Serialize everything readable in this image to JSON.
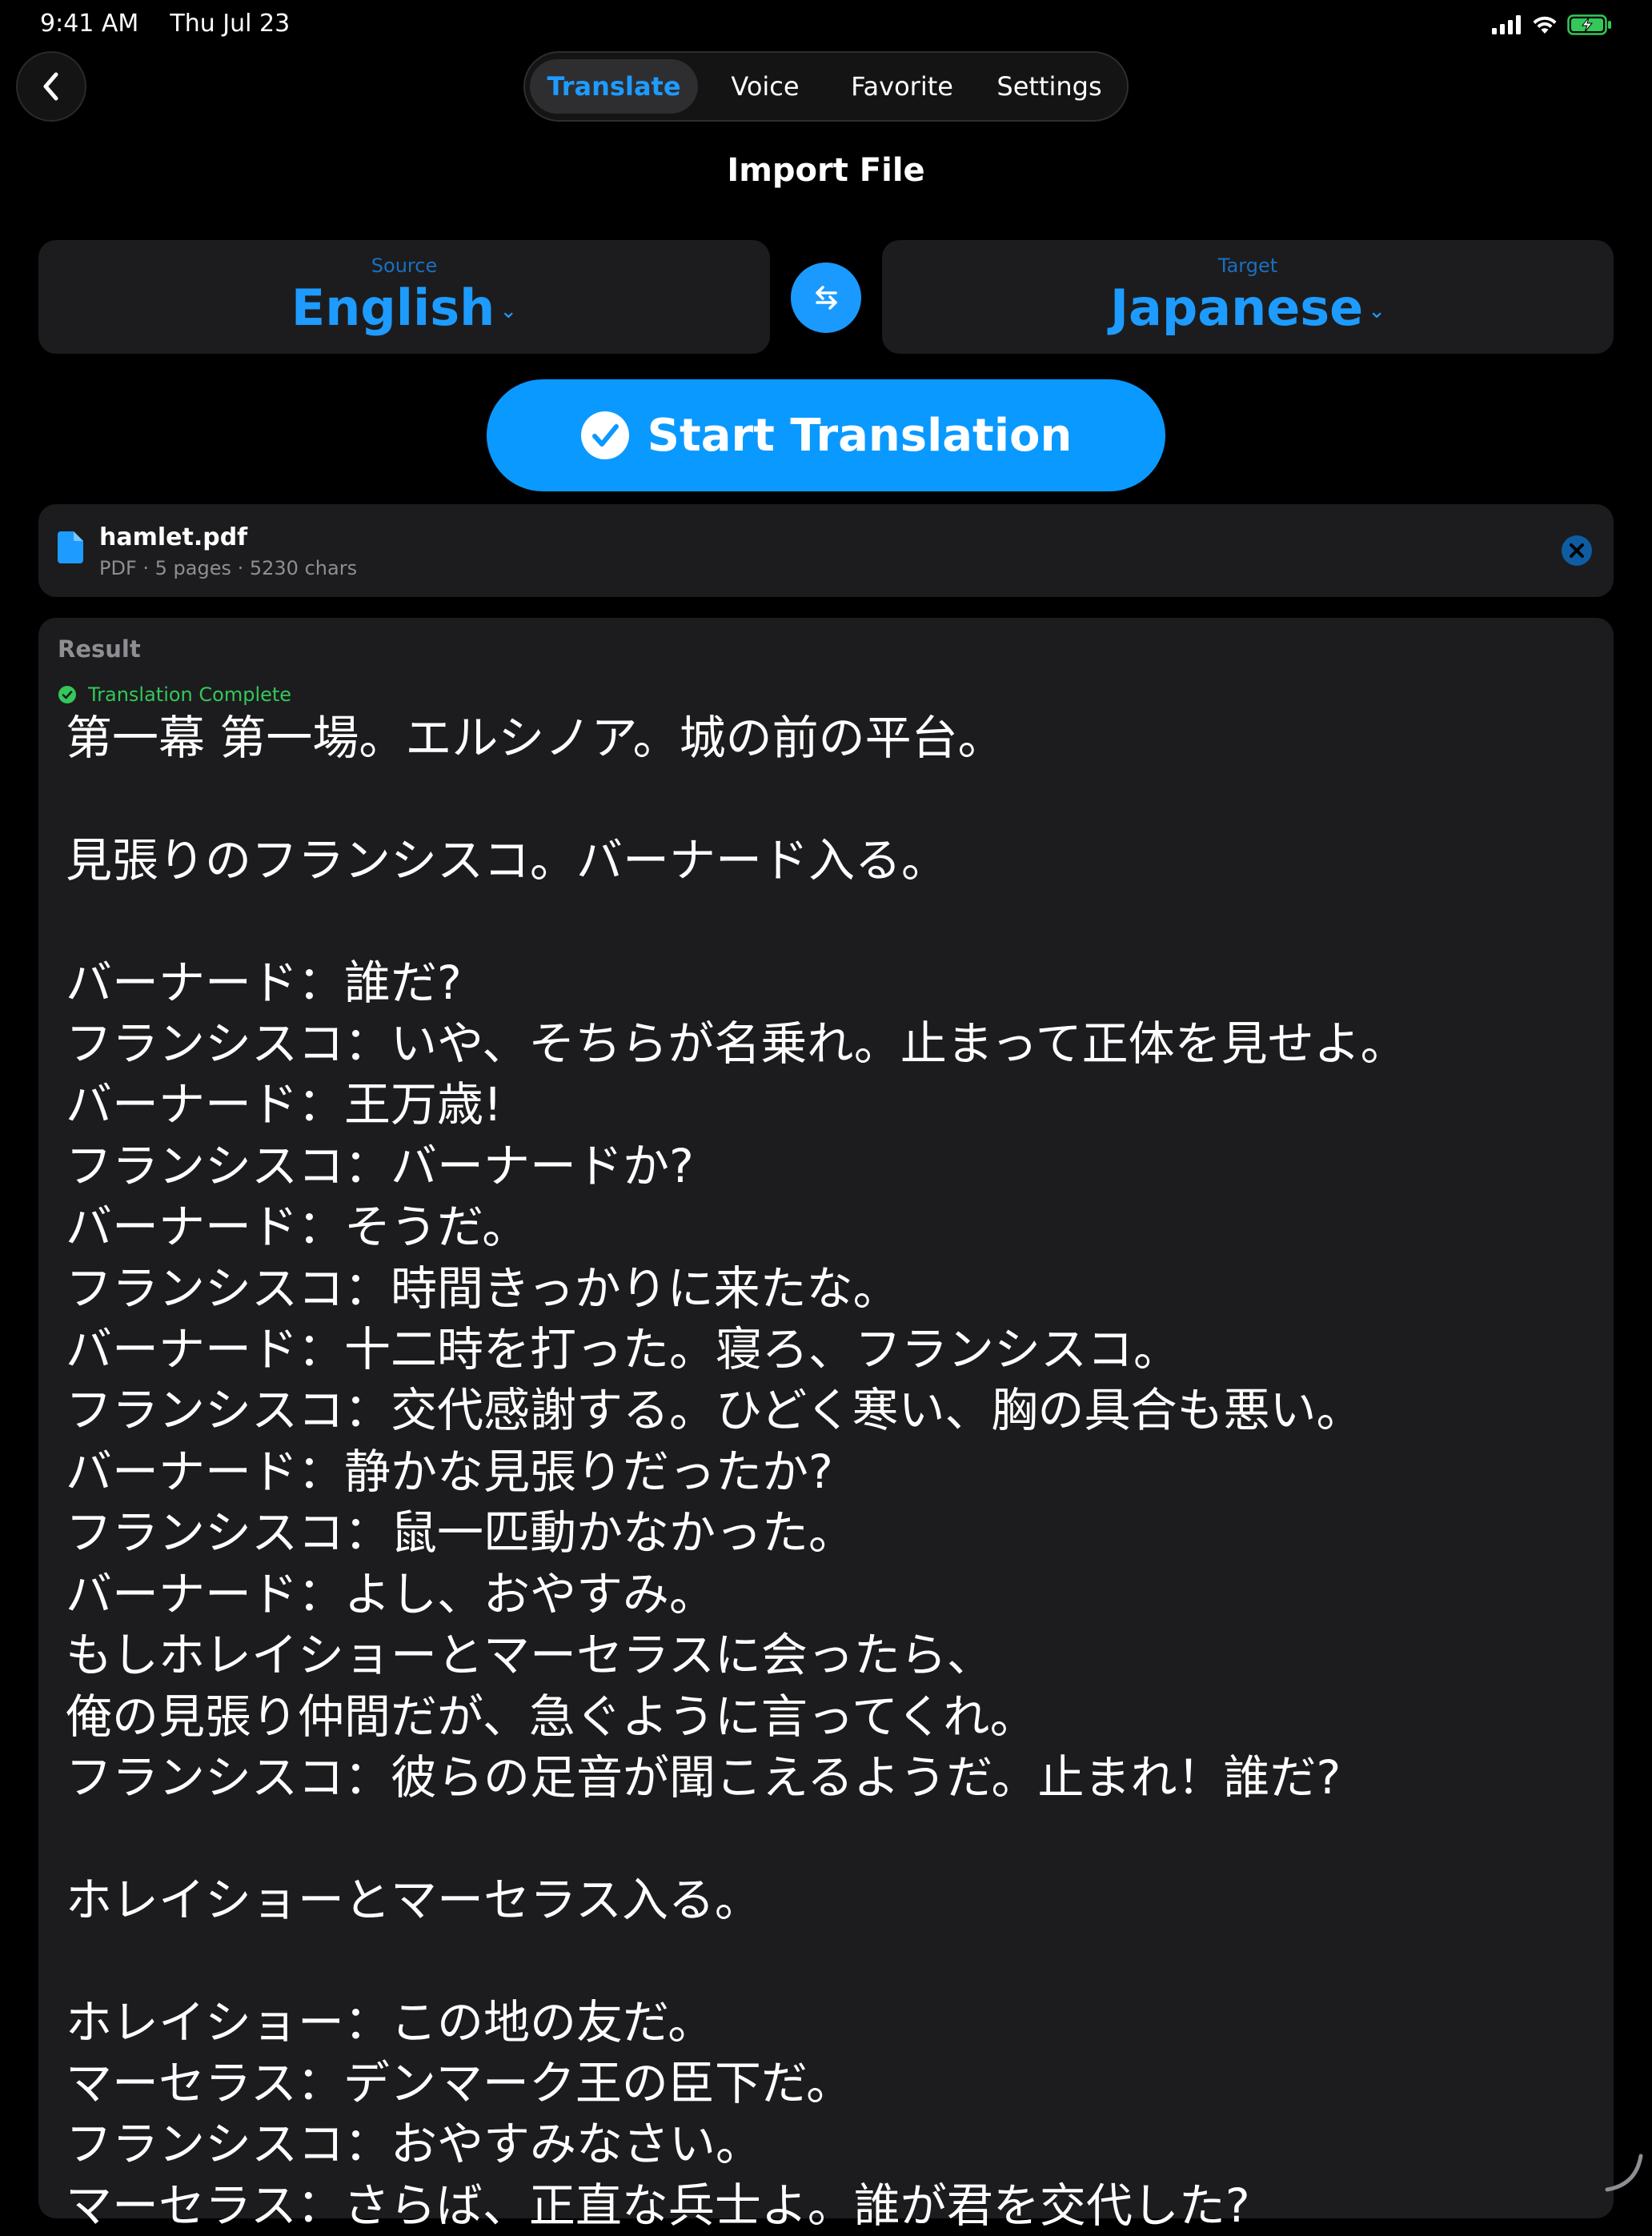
{
  "status_bar": {
    "time": "9:41 AM",
    "date": "Thu Jul 23",
    "icons": [
      "cellular-icon",
      "wifi-icon",
      "battery-charging-icon"
    ]
  },
  "nav": {
    "back_icon": "chevron-left-icon",
    "tabs": [
      {
        "label": "Translate",
        "active": true
      },
      {
        "label": "Voice",
        "active": false
      },
      {
        "label": "Favorite",
        "active": false
      },
      {
        "label": "Settings",
        "active": false
      }
    ]
  },
  "page": {
    "title": "Import File"
  },
  "languages": {
    "source": {
      "caption": "Source",
      "value": "English"
    },
    "target": {
      "caption": "Target",
      "value": "Japanese"
    },
    "swap_icon": "swap-arrows-icon"
  },
  "actions": {
    "start_label": "Start Translation",
    "start_icon": "checkmark-circle-icon"
  },
  "file": {
    "name": "hamlet.pdf",
    "meta": "PDF · 5 pages · 5230 chars",
    "icon": "document-icon",
    "remove_icon": "close-circle-icon"
  },
  "result": {
    "title": "Result",
    "status": "Translation Complete",
    "text": "第一幕 第一場。エルシノア。城の前の平台。\n\n見張りのフランシスコ。バーナード入る。\n\nバーナード：誰だ?\nフランシスコ：いや、そちらが名乗れ。止まって正体を見せよ。\nバーナード：王万歳!\nフランシスコ：バーナードか?\nバーナード：そうだ。\nフランシスコ：時間きっかりに来たな。\nバーナード：十二時を打った。寝ろ、フランシスコ。\nフランシスコ：交代感謝する。ひどく寒い、胸の具合も悪い。\nバーナード：静かな見張りだったか?\nフランシスコ：鼠一匹動かなかった。\nバーナード：よし、おやすみ。\nもしホレイショーとマーセラスに会ったら、\n俺の見張り仲間だが、急ぐように言ってくれ。\nフランシスコ：彼らの足音が聞こえるようだ。止まれ！誰だ?\n\nホレイショーとマーセラス入る。\n\nホレイショー：この地の友だ。\nマーセラス：デンマーク王の臣下だ。\nフランシスコ：おやすみなさい。\nマーセラス：さらば、正直な兵士よ。誰が君を交代した?"
  },
  "colors": {
    "accent": "#0a99ff",
    "success": "#34c759",
    "card": "#1c1c1e",
    "background": "#000000"
  }
}
